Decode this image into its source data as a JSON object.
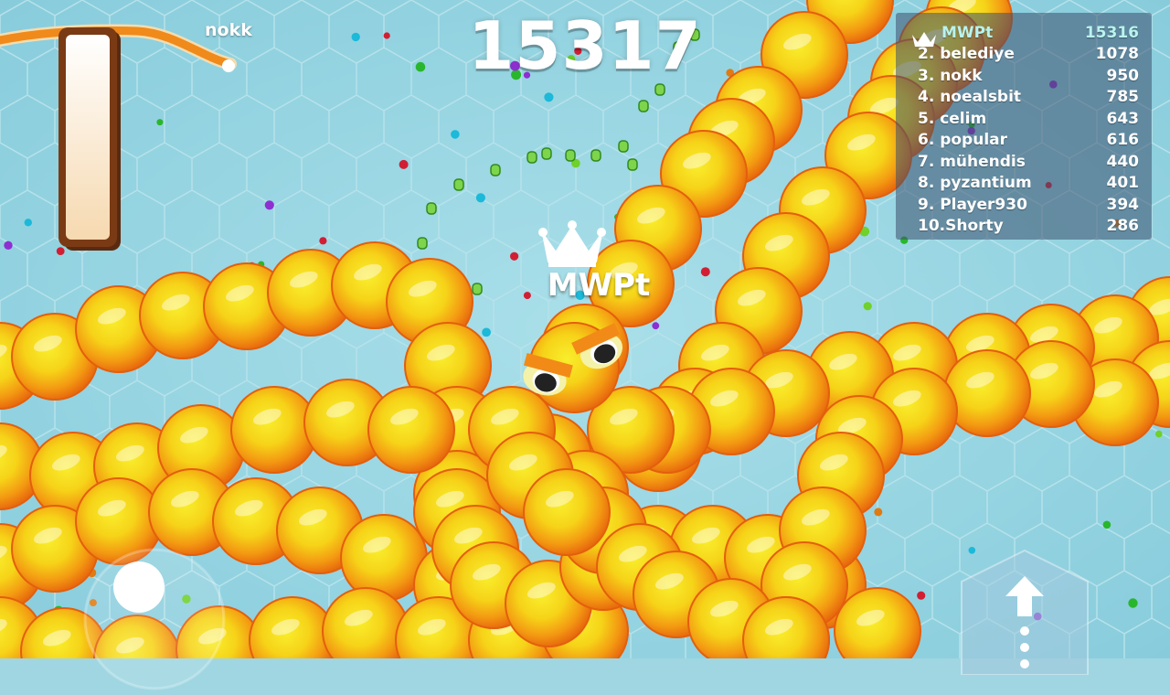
{
  "hud": {
    "score": "15317"
  },
  "player": {
    "name": "MWPt",
    "crown": "crown-icon"
  },
  "other_snake": {
    "name": "nokk"
  },
  "leaderboard": {
    "rows": [
      {
        "name": "MWPt",
        "score": "15316"
      },
      {
        "name": "2. belediye",
        "score": "1078"
      },
      {
        "name": "3. nokk",
        "score": "950"
      },
      {
        "name": "4. noealsbit",
        "score": "785"
      },
      {
        "name": "5. celim",
        "score": "643"
      },
      {
        "name": "6. popular",
        "score": "616"
      },
      {
        "name": "7. mühendis",
        "score": "440"
      },
      {
        "name": "8. pyzantium",
        "score": "401"
      },
      {
        "name": "9. Player930",
        "score": "394"
      },
      {
        "name": "10.Shorty",
        "score": "286"
      }
    ]
  },
  "controls": {
    "joystick": "joystick-icon",
    "boost": "arrow-up-icon"
  },
  "colors": {
    "background": "#9fd6e2",
    "snake_orange": "#f07a12",
    "snake_yellow": "#f6e318",
    "self_highlight": "#b9f3ee"
  }
}
